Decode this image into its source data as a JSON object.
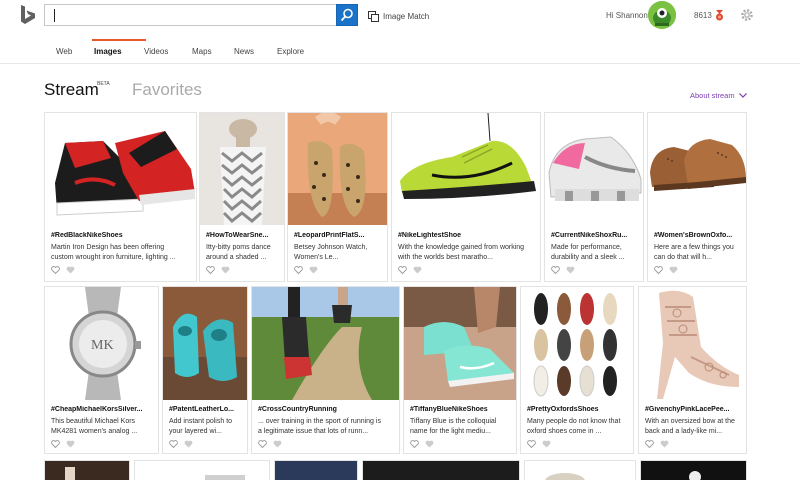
{
  "search": {
    "placeholder": "",
    "button_icon": "search-icon"
  },
  "header": {
    "image_match_label": "Image Match",
    "greeting": "Hi Shannon",
    "points": "8613"
  },
  "nav": {
    "items": [
      {
        "label": "Web",
        "active": false
      },
      {
        "label": "Images",
        "active": true
      },
      {
        "label": "Videos",
        "active": false
      },
      {
        "label": "Maps",
        "active": false
      },
      {
        "label": "News",
        "active": false
      },
      {
        "label": "Explore",
        "active": false
      }
    ]
  },
  "stream": {
    "title": "Stream",
    "beta": "BETA",
    "favorites": "Favorites",
    "about": "About stream"
  },
  "colors": {
    "accent_orange": "#e8592c",
    "search_blue": "#1a73c9",
    "about_purple": "#7a3fb0"
  },
  "cards": [
    {
      "tag": "#RedBlackNikeShoes",
      "desc1": "Martin Iron Design has been offering",
      "desc2": "custom wrought iron furniture, lighting ..."
    },
    {
      "tag": "#HowToWearSne...",
      "desc1": "Itty-bitty poms dance",
      "desc2": "around a shaded ..."
    },
    {
      "tag": "#LeopardPrintFlatS...",
      "desc1": "Betsey Johnson Watch,",
      "desc2": "Women's Le..."
    },
    {
      "tag": "#NikeLightestShoe",
      "desc1": "With the knowledge gained from working",
      "desc2": "with the worlds best maratho..."
    },
    {
      "tag": "#CurrentNikeShoxRu...",
      "desc1": "Made for performance,",
      "desc2": "durability and a sleek ..."
    },
    {
      "tag": "#Women'sBrownOxfo...",
      "desc1": "Here are a few things you",
      "desc2": "can do that will h..."
    },
    {
      "tag": "#CheapMichaelKorsSilver...",
      "desc1": "This beautiful Michael Kors",
      "desc2": "MK4281 women's analog ..."
    },
    {
      "tag": "#PatentLeatherLo...",
      "desc1": "Add instant polish to",
      "desc2": "your layered wi..."
    },
    {
      "tag": "#CrossCountryRunning",
      "desc1": "... over training in the sport of running is",
      "desc2": "a legitimate issue that lots of runn..."
    },
    {
      "tag": "#TiffanyBlueNikeShoes",
      "desc1": "Tiffany Blue is the colloquial",
      "desc2": "name for the light mediu..."
    },
    {
      "tag": "#PrettyOxfordsShoes",
      "desc1": "Many people do not know that",
      "desc2": "oxford shoes come in ..."
    },
    {
      "tag": "#GivenchyPinkLacePee...",
      "desc1": "With an oversized bow at the",
      "desc2": "back and a lady-like mi..."
    }
  ]
}
